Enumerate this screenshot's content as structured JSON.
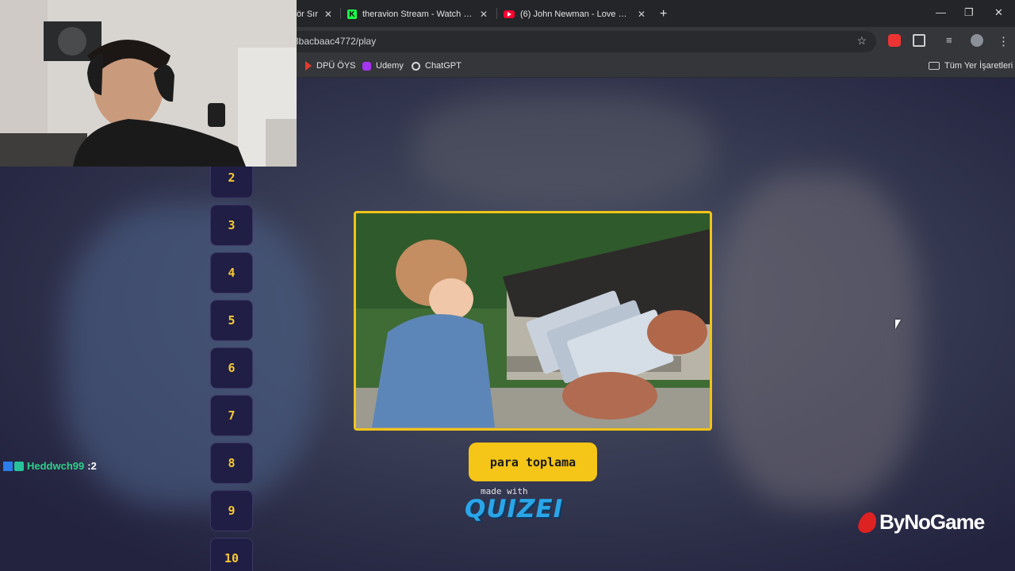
{
  "browser": {
    "tabs": [
      {
        "title": "ör Sır",
        "icon": "partial-tab"
      },
      {
        "title": "theravion Stream - Watch Live o",
        "icon": "kick-icon"
      },
      {
        "title": "(6) John Newman - Love Me Ag",
        "icon": "youtube-icon"
      }
    ],
    "new_tab_symbol": "+",
    "url": "3bacbaac4772/play",
    "bookmarks": [
      {
        "label": "DPÜ ÖYS",
        "icon": "dpu-icon"
      },
      {
        "label": "Udemy",
        "icon": "udemy-icon"
      },
      {
        "label": "ChatGPT",
        "icon": "chatgpt-icon"
      }
    ],
    "all_bookmarks_label": "Tüm Yer İşaretleri"
  },
  "quiz": {
    "question_numbers": [
      "2",
      "3",
      "4",
      "5",
      "6",
      "7",
      "8",
      "9",
      "10"
    ],
    "answer_label": "para toplama",
    "made_with": "made with",
    "brand": "QUIZEI"
  },
  "overlay": {
    "chat_user": "Heddwch99",
    "chat_message": ":2",
    "sponsor": "ByNoGame"
  },
  "colors": {
    "accent": "#f5c518",
    "tile_bg": "#211e45",
    "chat_user": "#2fd18b"
  }
}
